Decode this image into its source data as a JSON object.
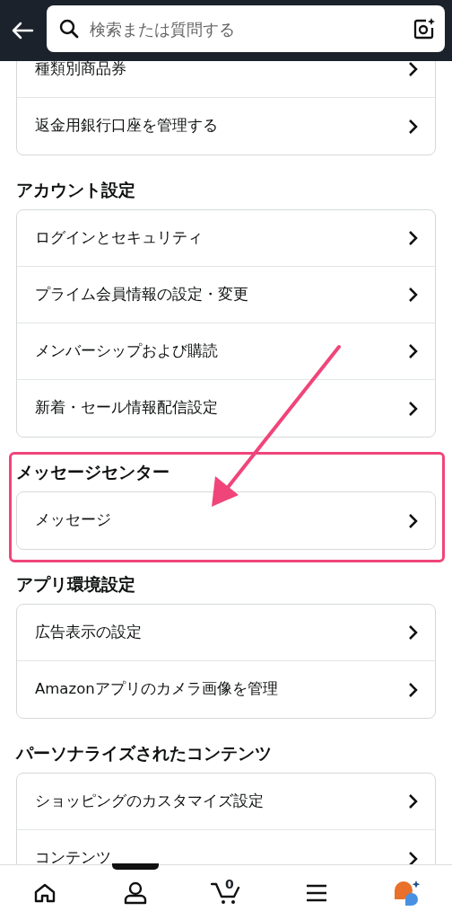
{
  "header": {
    "search": {
      "placeholder": "検索または質問する"
    }
  },
  "sections": [
    {
      "highlighted": false,
      "items": [
        "種類別商品券",
        "返金用銀行口座を管理する"
      ]
    },
    {
      "title": "アカウント設定",
      "highlighted": false,
      "items": [
        "ログインとセキュリティ",
        "プライム会員情報の設定・変更",
        "メンバーシップおよび購読",
        "新着・セール情報配信設定"
      ]
    },
    {
      "title": "メッセージセンター",
      "highlighted": true,
      "items": [
        "メッセージ"
      ]
    },
    {
      "title": "アプリ環境設定",
      "highlighted": false,
      "items": [
        "広告表示の設定",
        "Amazonアプリのカメラ画像を管理"
      ]
    },
    {
      "title": "パーソナライズされたコンテンツ",
      "highlighted": false,
      "items": [
        "ショッピングのカスタマイズ設定",
        "コンテンツ"
      ]
    }
  ],
  "bottom_nav": [
    {
      "kind": "home",
      "selected": false
    },
    {
      "kind": "account",
      "selected": true
    },
    {
      "kind": "cart",
      "selected": false,
      "count": "0"
    },
    {
      "kind": "menu",
      "selected": false
    },
    {
      "kind": "assistant",
      "selected": false
    }
  ]
}
